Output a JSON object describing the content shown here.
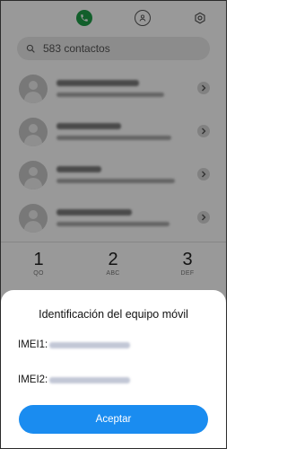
{
  "search": {
    "placeholder": "583 contactos"
  },
  "tabs": [
    {
      "name": "phone-icon",
      "active": true
    },
    {
      "name": "contacts-icon",
      "active": false
    },
    {
      "name": "settings-icon",
      "active": false
    }
  ],
  "keypad": [
    {
      "digit": "1",
      "letters": "QO"
    },
    {
      "digit": "2",
      "letters": "ABC"
    },
    {
      "digit": "3",
      "letters": "DEF"
    }
  ],
  "dialog": {
    "title": "Identificación del equipo móvil",
    "imei1_label": "IMEI1:",
    "imei2_label": "IMEI2:",
    "accept_label": "Aceptar"
  },
  "colors": {
    "accent": "#1a8cf0",
    "phone_tab": "#1e9e48",
    "overlay": "rgba(0,0,0,0.40)"
  }
}
